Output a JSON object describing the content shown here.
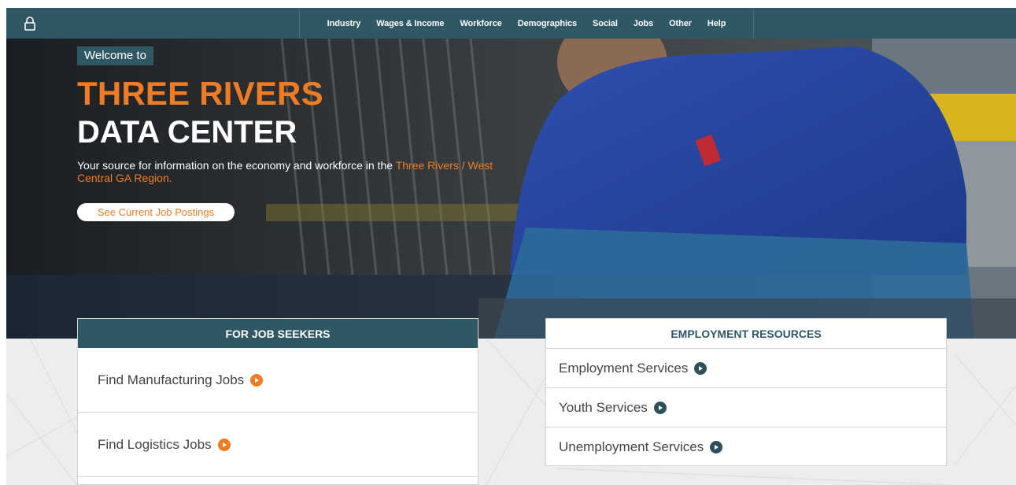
{
  "colors": {
    "nav_bg": "#2f5764",
    "accent": "#ef7c24",
    "card_header": "#2f5764",
    "page_bg": "#ededed"
  },
  "topnav": {
    "home_icon": "lock-icon",
    "items": [
      "Industry",
      "Wages & Income",
      "Workforce",
      "Demographics",
      "Social",
      "Jobs",
      "Other",
      "Help"
    ]
  },
  "hero": {
    "welcome": "Welcome to",
    "title_line1": "THREE RIVERS",
    "title_line2": "DATA CENTER",
    "desc_plain": "Your source for information on the economy and workforce in the ",
    "desc_highlight": "Three Rivers / West Central GA Region.",
    "cta_label": "See Current Job Postings"
  },
  "job_seekers": {
    "header": "FOR JOB SEEKERS",
    "items": [
      "Find Manufacturing Jobs",
      "Find Logistics Jobs"
    ],
    "item_icon": "arrow-circle-icon"
  },
  "employment_resources": {
    "header": "EMPLOYMENT RESOURCES",
    "items": [
      "Employment Services",
      "Youth Services",
      "Unemployment Services"
    ],
    "item_icon": "arrow-circle-icon"
  }
}
